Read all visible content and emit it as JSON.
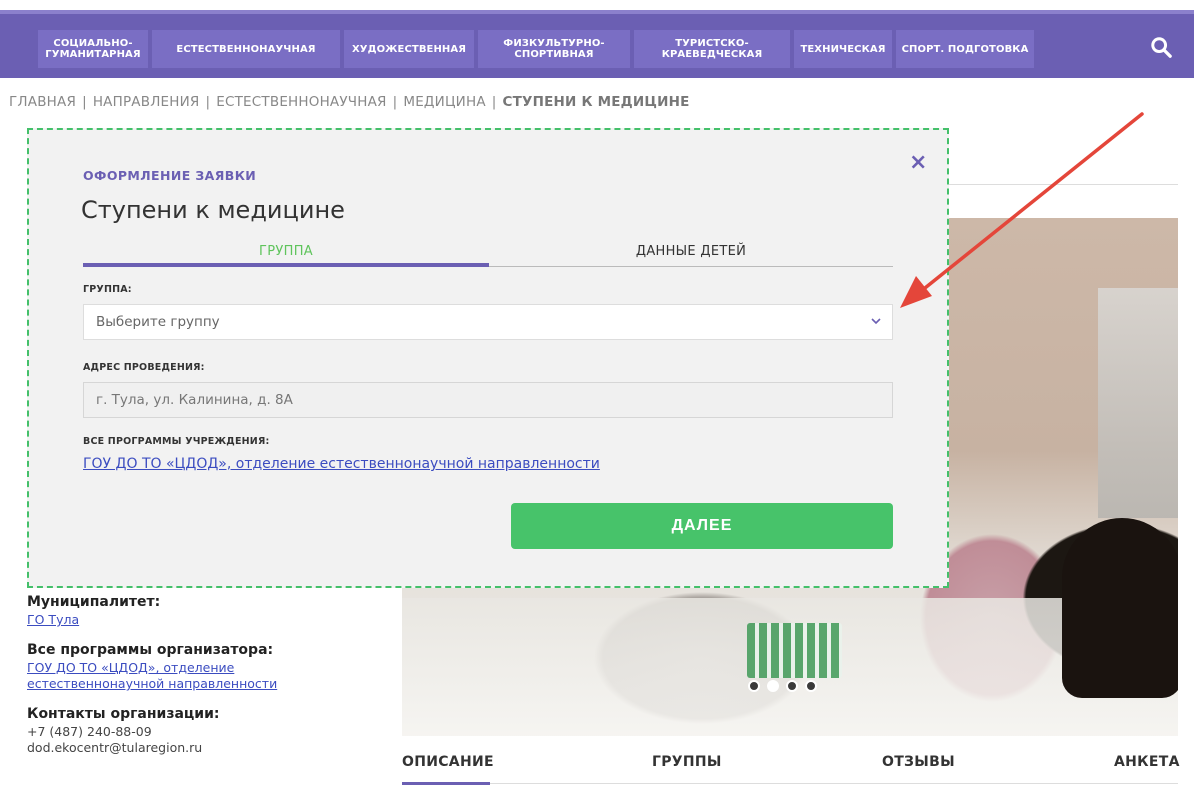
{
  "nav": {
    "items": [
      "СОЦИАЛЬНО-\nГУМАНИТАРНАЯ",
      "ЕСТЕСТВЕННОНАУЧНАЯ",
      "ХУДОЖЕСТВЕННАЯ",
      "ФИЗКУЛЬТУРНО-\nСПОРТИВНАЯ",
      "ТУРИСТСКО-\nКРАЕВЕДЧЕСКАЯ",
      "ТЕХНИЧЕСКАЯ",
      "СПОРТ. ПОДГОТОВКА"
    ],
    "search_icon": "search-icon"
  },
  "breadcrumb": {
    "items": [
      "ГЛАВНАЯ",
      "НАПРАВЛЕНИЯ",
      "ЕСТЕСТВЕННОНАУЧНАЯ",
      "МЕДИЦИНА"
    ],
    "current": "СТУПЕНИ К МЕДИЦИНЕ",
    "separator": "|"
  },
  "modal": {
    "subtitle": "ОФОРМЛЕНИЕ ЗАЯВКИ",
    "title": "Ступени к медицине",
    "tabs": [
      {
        "label": "ГРУППА",
        "active": true
      },
      {
        "label": "ДАННЫЕ ДЕТЕЙ",
        "active": false
      }
    ],
    "group_label": "ГРУППА:",
    "group_placeholder": "Выберите группу",
    "address_label": "АДРЕС ПРОВЕДЕНИЯ:",
    "address_value": "г. Тула, ул. Калинина, д. 8А",
    "programs_label": "ВСЕ ПРОГРАММЫ УЧРЕЖДЕНИЯ:",
    "programs_link": "ГОУ ДО ТО «ЦДОД», отделение естественнонаучной направленности",
    "next_label": "ДАЛЕЕ",
    "close_icon": "×"
  },
  "sidebar": {
    "municipality_title": "Муниципалитет:",
    "municipality_link": "ГО Тула",
    "organizer_title": "Все программы организатора:",
    "organizer_link_1": "ГОУ ДО ТО «ЦДОД», отделение",
    "organizer_link_2": "естественнонаучной направленности",
    "contacts_title": "Контакты организации:",
    "phone": "+7 (487) 240-88-09",
    "email": "dod.ekocentr@tularegion.ru"
  },
  "content_tabs": [
    "ОПИСАНИЕ",
    "ГРУППЫ",
    "ОТЗЫВЫ",
    "АНКЕТА"
  ],
  "colors": {
    "brand": "#6b5fb3",
    "accent_green": "#47c36a",
    "active_tab_text": "#5fc45c",
    "link": "#3b4cc0",
    "annotation_arrow": "#e4463a"
  }
}
